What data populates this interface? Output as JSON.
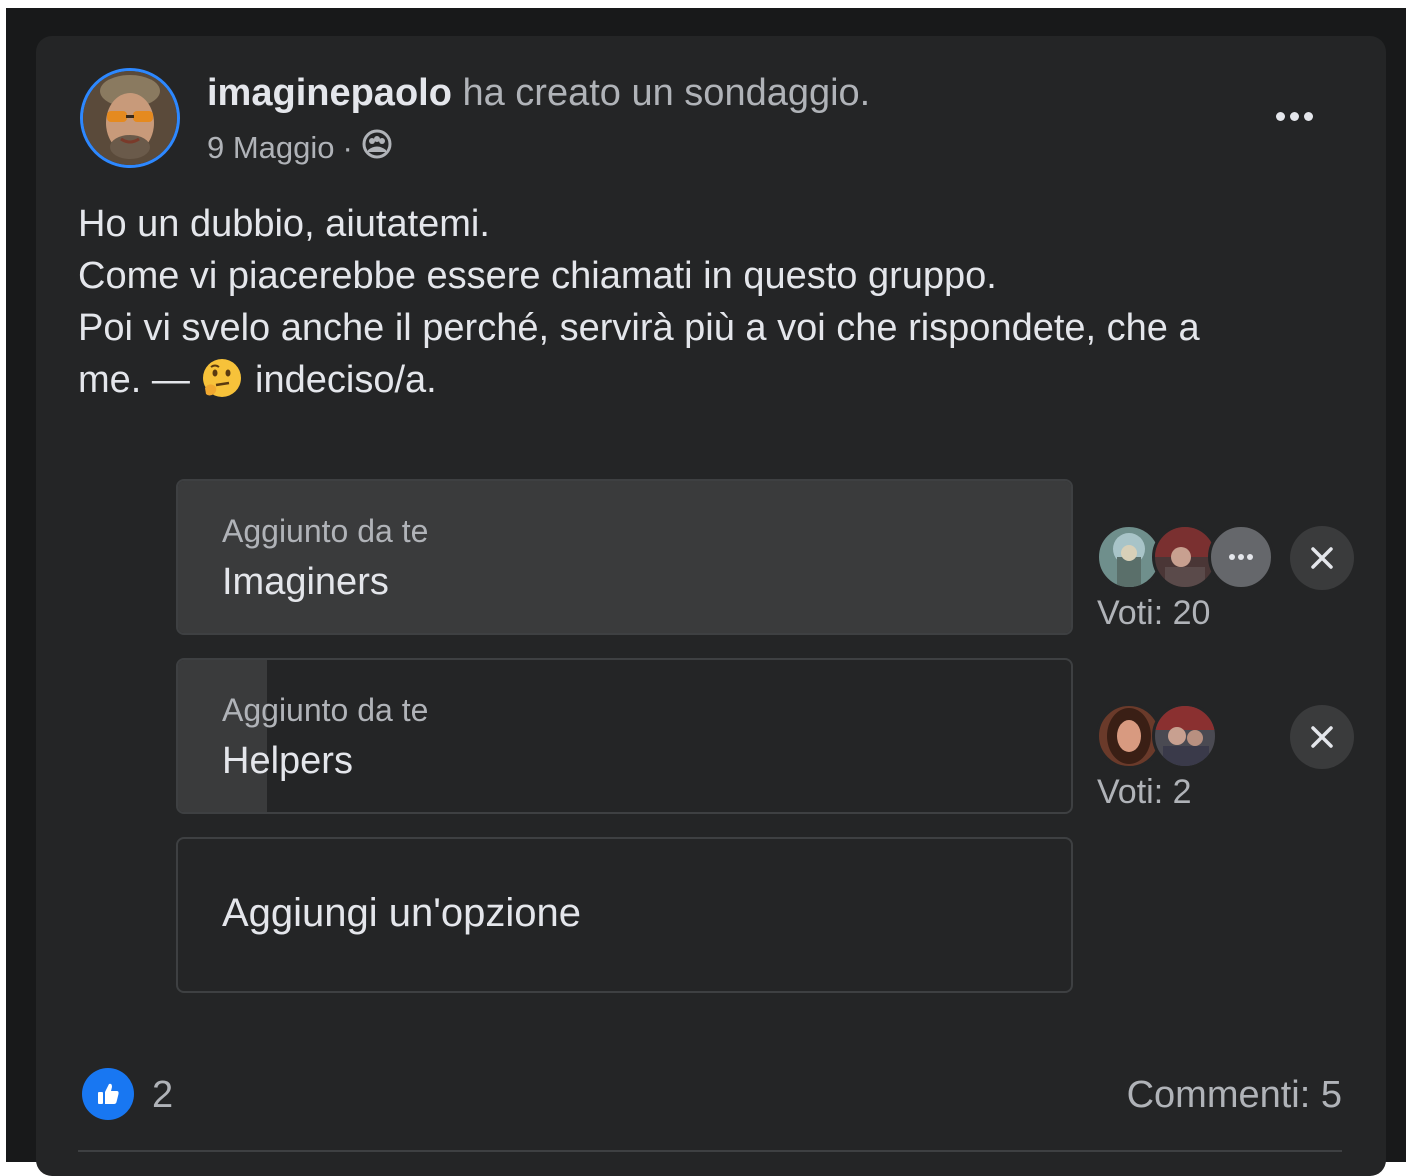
{
  "post": {
    "author": "imaginepaolo",
    "action": "ha creato un sondaggio.",
    "date": "9 Maggio",
    "separator": "·",
    "audience_icon": "group-icon",
    "more_icon": "more-dots-icon",
    "text_lines": [
      "Ho un dubbio, aiutatemi.",
      "Come vi piacerebbe essere chiamati in questo gruppo.",
      "Poi vi svelo anche il perché, servirà più a voi che rispondete, che a"
    ],
    "last_line_prefix": "me. —",
    "feeling_emoji": "thinking-face-emoji",
    "feeling_text": "indeciso/a."
  },
  "poll": {
    "options": [
      {
        "added_by": "Aggiunto da te",
        "label": "Imaginers",
        "votes_text": "Voti: 20",
        "vote_share": 1.0,
        "voter_avatars": [
          "voter-photo-1",
          "voter-photo-2",
          "more-voters"
        ]
      },
      {
        "added_by": "Aggiunto da te",
        "label": "Helpers",
        "votes_text": "Voti: 2",
        "vote_share": 0.1,
        "voter_avatars": [
          "voter-photo-3",
          "voter-photo-4"
        ]
      }
    ],
    "add_option_label": "Aggiungi un'opzione",
    "remove_icon": "close-icon"
  },
  "footer": {
    "like_icon": "thumbs-up-icon",
    "like_count": "2",
    "comments": "Commenti: 5"
  },
  "colors": {
    "background": "#18191a",
    "card": "#242526",
    "fill": "#3a3b3c",
    "text_primary": "#e4e6eb",
    "text_secondary": "#b0b3b8",
    "accent": "#1877f2"
  }
}
